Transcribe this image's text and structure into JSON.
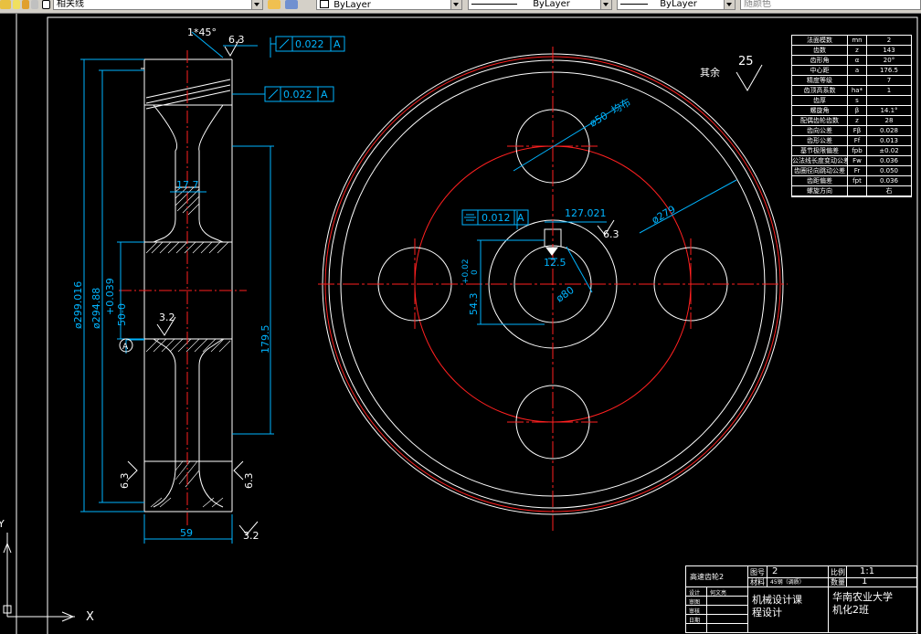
{
  "toolbar": {
    "layer_combo": "相关线",
    "color_combo": "ByLayer",
    "linetype_combo": "ByLayer",
    "lineweight_combo": "ByLayer",
    "plotstyle_combo": "随颜色"
  },
  "drawing": {
    "section_dims": {
      "chamfer": "1*45°",
      "roughness_top": "6.3",
      "runout_1": "0.022",
      "runout_2": "0.022",
      "datum_letter": "A",
      "web_width": "17.7",
      "dia_outer": "ø299.016",
      "dia_tip": "ø294.88",
      "tol_upper": "+0.039",
      "hub_bore": "50-0",
      "roughness_hub": "3.2",
      "datum_label": "A",
      "height_179": "179.5",
      "roughness_left": "6.3",
      "roughness_right": "6.3",
      "face_width": "59",
      "roughness_bottom": "3.2"
    },
    "front_dims": {
      "surface_rest_label": "其余",
      "surface_rest_value": "25",
      "hole_dia": "ø50",
      "hole_note": "均布",
      "pcd_dia": "ø279",
      "sym_tol": "0.012",
      "sym_datum": "A",
      "keyway_depth": "127.021",
      "keyway_rough": "6.3",
      "key_width": "12.5",
      "hub_height": "54.3",
      "hub_tol_upper": "+0.02",
      "hub_tol_lower": "0",
      "bore_dia": "ø80"
    },
    "param_table": [
      [
        "法面模数",
        "mn",
        "2"
      ],
      [
        "齿数",
        "z",
        "143"
      ],
      [
        "齿形角",
        "α",
        "20°"
      ],
      [
        "中心距",
        "a",
        "176.5"
      ],
      [
        "精度等级",
        "",
        "7"
      ],
      [
        "齿顶高系数",
        "ha*",
        "1"
      ],
      [
        "齿厚",
        "s",
        ""
      ],
      [
        "螺旋角",
        "β",
        "14.1°"
      ],
      [
        "配偶齿轮齿数",
        "z",
        "28"
      ],
      [
        "齿向公差",
        "Fβ",
        "0.028"
      ],
      [
        "齿形公差",
        "Ff",
        "0.013"
      ],
      [
        "基节极限偏差",
        "fpb",
        "±0.02"
      ],
      [
        "公法线长度变动公差",
        "Fw",
        "0.036"
      ],
      [
        "齿圈径向跳动公差",
        "Fr",
        "0.050"
      ],
      [
        "齿距偏差",
        "fpt",
        "0.036"
      ],
      [
        "螺旋方向",
        "",
        "右"
      ]
    ],
    "title_block": {
      "part_name": "高速齿轮2",
      "drawing_no_label": "图号",
      "drawing_no": "2",
      "scale_label": "比例",
      "scale": "1:1",
      "material_label": "材料",
      "material": "45钢（调质）",
      "qty_label": "数量",
      "qty": "1",
      "designer_label": "设计",
      "designer": "何文亮",
      "drawn_label": "审图",
      "checked_label": "审核",
      "date_label": "日期",
      "course": "机械设计课程设计",
      "course_line1": "机械设计课",
      "course_line2": "程设计",
      "school_line1": "华南农业大学",
      "school_line2": "机化2班"
    },
    "ucs": {
      "x_label": "X",
      "y_label": "Y"
    }
  },
  "colors": {
    "white": "#ffffff",
    "red": "#ff2020",
    "cyan": "#00b4ff",
    "toolbar": "#d4d0c8"
  }
}
